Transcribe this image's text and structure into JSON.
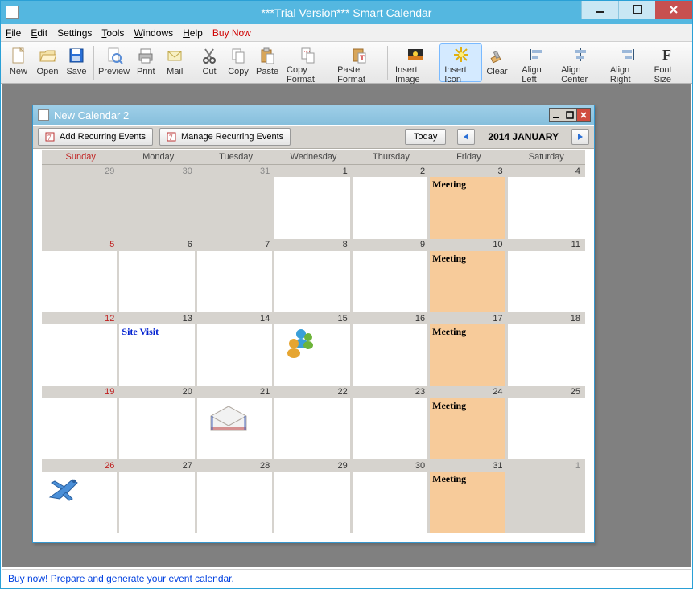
{
  "window": {
    "title": "***Trial Version*** Smart Calendar"
  },
  "menu": {
    "file": "File",
    "edit": "Edit",
    "settings": "Settings",
    "tools": "Tools",
    "windows": "Windows",
    "help": "Help",
    "buynow": "Buy Now"
  },
  "toolbar": {
    "new": "New",
    "open": "Open",
    "save": "Save",
    "preview": "Preview",
    "print": "Print",
    "mail": "Mail",
    "cut": "Cut",
    "copy": "Copy",
    "paste": "Paste",
    "copyfmt": "Copy Format",
    "pastefmt": "Paste Format",
    "insimg": "Insert Image",
    "insicon": "Insert Icon",
    "clear": "Clear",
    "alignl": "Align Left",
    "alignc": "Align Center",
    "alignr": "Align Right",
    "fontsize": "Font Size"
  },
  "doc": {
    "title": "New Calendar 2",
    "add_recurring": "Add Recurring Events",
    "manage_recurring": "Manage Recurring Events",
    "today": "Today",
    "month": "2014 JANUARY"
  },
  "days": {
    "sun": "Sunday",
    "mon": "Monday",
    "tue": "Tuesday",
    "wed": "Wednesday",
    "thu": "Thursday",
    "fri": "Friday",
    "sat": "Saturday"
  },
  "grid": {
    "r1": {
      "d": [
        "29",
        "30",
        "31",
        "1",
        "2",
        "3",
        "4"
      ]
    },
    "r2": {
      "d": [
        "5",
        "6",
        "7",
        "8",
        "9",
        "10",
        "11"
      ]
    },
    "r3": {
      "d": [
        "12",
        "13",
        "14",
        "15",
        "16",
        "17",
        "18"
      ]
    },
    "r4": {
      "d": [
        "19",
        "20",
        "21",
        "22",
        "23",
        "24",
        "25"
      ]
    },
    "r5": {
      "d": [
        "26",
        "27",
        "28",
        "29",
        "30",
        "31",
        "1"
      ]
    }
  },
  "events": {
    "meeting": "Meeting",
    "sitevisit": "Site Visit"
  },
  "status": "Buy now! Prepare and generate your event calendar."
}
